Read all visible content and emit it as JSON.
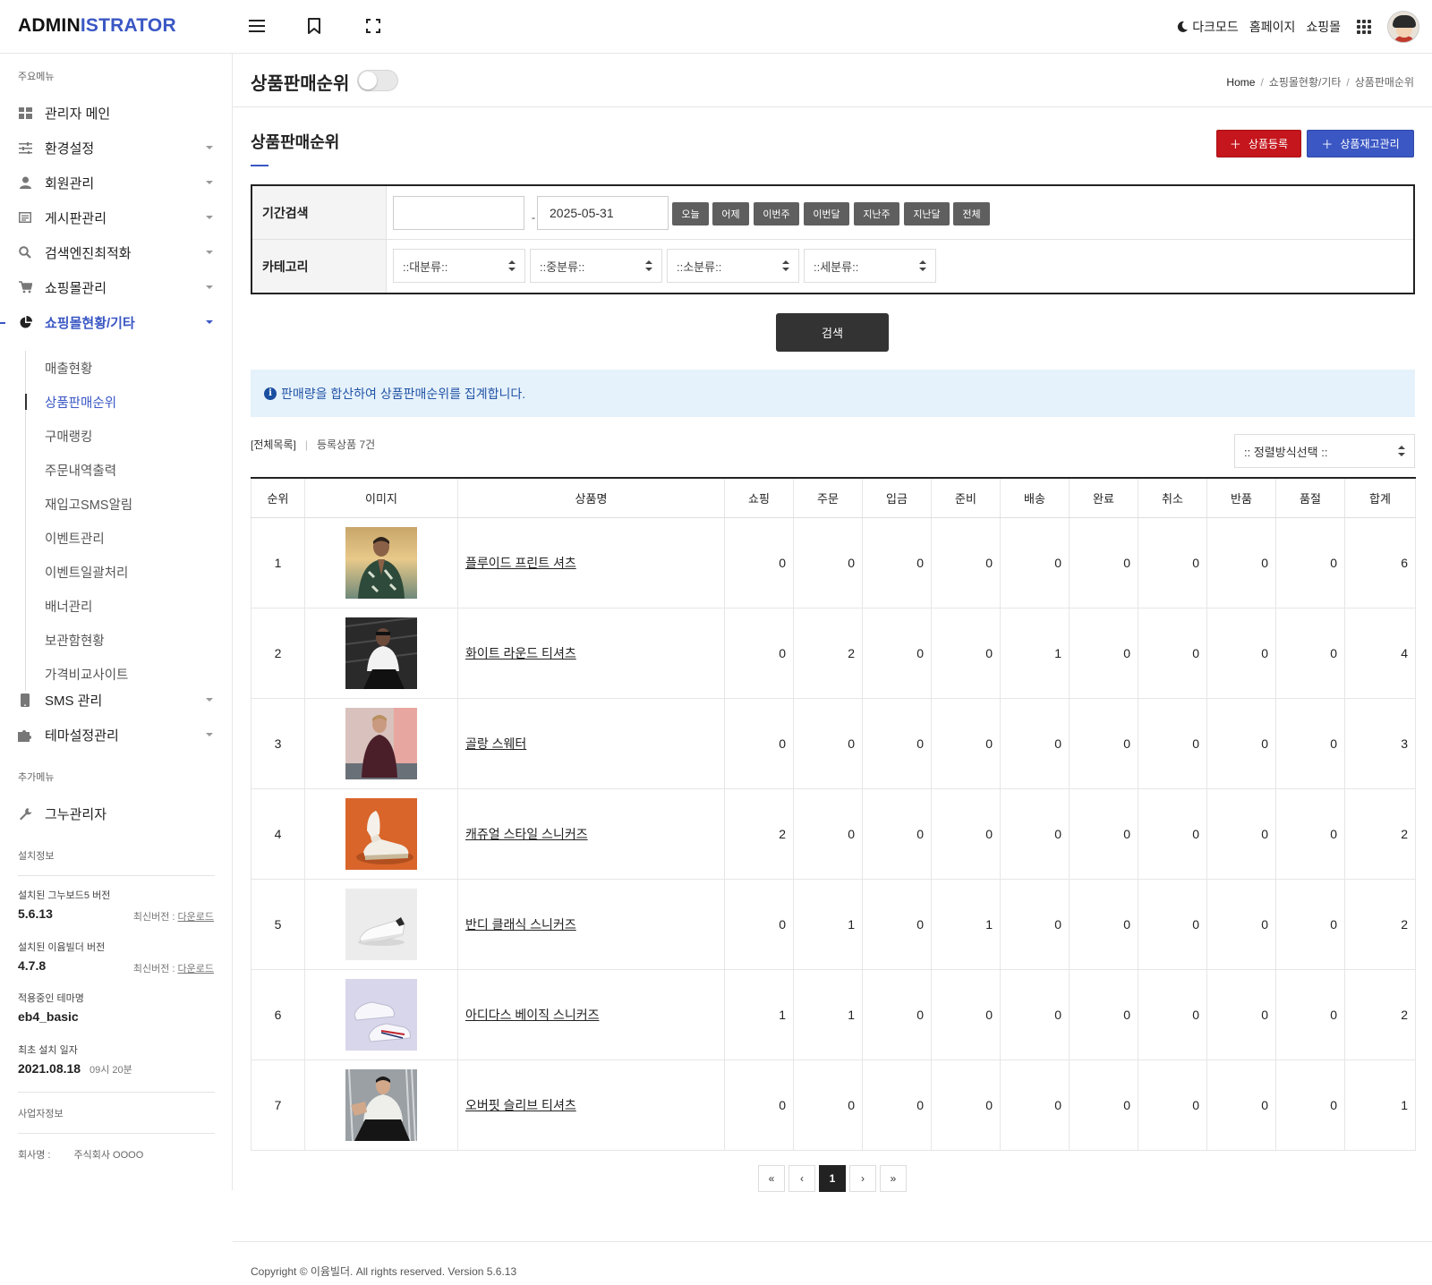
{
  "header": {
    "logo_part1": "ADMIN",
    "logo_part2": "ISTRATOR",
    "dark_mode": "다크모드",
    "homepage": "홈페이지",
    "shop": "쇼핑몰"
  },
  "sidebar": {
    "main_menu_label": "주요메뉴",
    "items": [
      {
        "label": "관리자 메인",
        "icon": "dashboard-icon"
      },
      {
        "label": "환경설정",
        "icon": "sliders-icon"
      },
      {
        "label": "회원관리",
        "icon": "user-icon"
      },
      {
        "label": "게시판관리",
        "icon": "board-icon"
      },
      {
        "label": "검색엔진최적화",
        "icon": "search-icon"
      },
      {
        "label": "쇼핑몰관리",
        "icon": "cart-icon"
      },
      {
        "label": "쇼핑몰현황/기타",
        "icon": "pie-chart-icon"
      },
      {
        "label": "SMS 관리",
        "icon": "mobile-icon"
      },
      {
        "label": "테마설정관리",
        "icon": "puzzle-icon"
      }
    ],
    "sub_items": [
      "매출현황",
      "상품판매순위",
      "구매랭킹",
      "주문내역출력",
      "재입고SMS알림",
      "이벤트관리",
      "이벤트일괄처리",
      "배너관리",
      "보관함현황",
      "가격비교사이트"
    ],
    "extra_menu_label": "추가메뉴",
    "extra_item": "그누관리자",
    "install_label": "설치정보",
    "gnuboard_label": "설치된 그누보드5 버전",
    "gnuboard_version": "5.6.13",
    "latest_prefix": "최신버전 :",
    "download": "다운로드",
    "eyoom_label": "설치된 이윰빌더 버전",
    "eyoom_version": "4.7.8",
    "theme_label": "적용중인 테마명",
    "theme_name": "eb4_basic",
    "first_install_label": "최초 설치 일자",
    "first_install_date": "2021.08.18",
    "first_install_time": "09시 20분",
    "business_label": "사업자정보",
    "company_label": "회사명 :",
    "company_name": "주식회사 OOOO"
  },
  "page": {
    "title": "상품판매순위",
    "breadcrumb": [
      "Home",
      "쇼핑몰현황/기타",
      "상품판매순위"
    ],
    "section_title": "상품판매순위",
    "btn_add": "상품등록",
    "btn_stock": "상품재고관리"
  },
  "search": {
    "period_label": "기간검색",
    "date_from": "",
    "date_to": "2025-05-31",
    "quick_buttons": [
      "오늘",
      "어제",
      "이번주",
      "이번달",
      "지난주",
      "지난달",
      "전체"
    ],
    "category_label": "카테고리",
    "categories": [
      "::대분류::",
      "::중분류::",
      "::소분류::",
      "::세분류::"
    ],
    "search_button": "검색"
  },
  "notice": "판매량을 합산하여 상품판매순위를 집계합니다.",
  "list": {
    "all_label": "[전체목록]",
    "count_label": "등록상품 7건",
    "sort_placeholder": ":: 정렬방식선택 ::"
  },
  "table": {
    "headers": [
      "순위",
      "이미지",
      "상품명",
      "쇼핑",
      "주문",
      "입금",
      "준비",
      "배송",
      "완료",
      "취소",
      "반품",
      "품절",
      "합계"
    ],
    "rows": [
      {
        "rank": "1",
        "name": "플루이드 프린트 셔츠",
        "values": [
          "0",
          "0",
          "0",
          "0",
          "0",
          "0",
          "0",
          "0",
          "0",
          "6"
        ]
      },
      {
        "rank": "2",
        "name": "화이트 라운드 티셔츠",
        "values": [
          "0",
          "2",
          "0",
          "0",
          "1",
          "0",
          "0",
          "0",
          "0",
          "4"
        ]
      },
      {
        "rank": "3",
        "name": "골랑 스웨터",
        "values": [
          "0",
          "0",
          "0",
          "0",
          "0",
          "0",
          "0",
          "0",
          "0",
          "3"
        ]
      },
      {
        "rank": "4",
        "name": "캐쥬얼 스타일 스니커즈",
        "values": [
          "2",
          "0",
          "0",
          "0",
          "0",
          "0",
          "0",
          "0",
          "0",
          "2"
        ]
      },
      {
        "rank": "5",
        "name": "반디 클래식 스니커즈",
        "values": [
          "0",
          "1",
          "0",
          "1",
          "0",
          "0",
          "0",
          "0",
          "0",
          "2"
        ]
      },
      {
        "rank": "6",
        "name": "아디다스 베이직 스니커즈",
        "values": [
          "1",
          "1",
          "0",
          "0",
          "0",
          "0",
          "0",
          "0",
          "0",
          "2"
        ]
      },
      {
        "rank": "7",
        "name": "오버핏 슬리브 티셔츠",
        "values": [
          "0",
          "0",
          "0",
          "0",
          "0",
          "0",
          "0",
          "0",
          "0",
          "1"
        ]
      }
    ]
  },
  "pagination": {
    "first": "«",
    "prev": "‹",
    "current": "1",
    "next": "›",
    "last": "»"
  },
  "footer": {
    "copyright": "Copyright © 이윰빌더. All rights reserved. Version 5.6.13"
  },
  "colors": {
    "accent": "#3a57c4",
    "red_button": "#c4161c",
    "notice_bg": "#e6f2fb"
  }
}
